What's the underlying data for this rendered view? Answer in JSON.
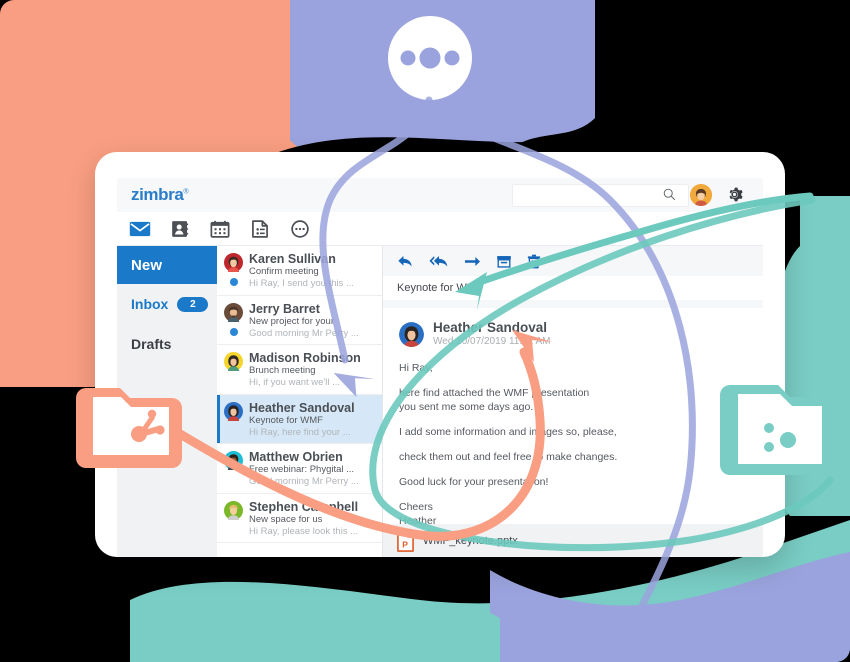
{
  "app": {
    "brand": "zimbra",
    "brand_mark": "®"
  },
  "header": {
    "search_placeholder": "",
    "search_value": "",
    "search_icon": "search-icon",
    "avatar_icon": "user-avatar",
    "settings_icon": "gear-icon"
  },
  "nav": {
    "items": [
      {
        "icon": "mail-icon",
        "label": "Mail",
        "active": true
      },
      {
        "icon": "contacts-icon",
        "label": "Contacts",
        "active": false
      },
      {
        "icon": "calendar-icon",
        "label": "Calendar",
        "active": false
      },
      {
        "icon": "tasks-icon",
        "label": "Tasks",
        "active": false
      },
      {
        "icon": "more-icon",
        "label": "More",
        "active": false
      }
    ]
  },
  "sidebar": {
    "new_label": "New",
    "folders": [
      {
        "label": "Inbox",
        "badge": "2",
        "active": true
      },
      {
        "label": "Drafts",
        "badge": "",
        "active": false
      }
    ]
  },
  "maillist": {
    "messages": [
      {
        "sender": "Karen Sullivan",
        "subject": "Confirm meeting",
        "preview": "Hi Ray, I send you this ...",
        "unread": true,
        "selected": false,
        "avatar_color": "#c0272d",
        "avatar_icon": "avatar-karen-sullivan"
      },
      {
        "sender": "Jerry Barret",
        "subject": "New project for your",
        "preview": "Good morning Mr Perry ...",
        "unread": true,
        "selected": false,
        "avatar_color": "#6b4c3b",
        "avatar_icon": "avatar-jerry-barret"
      },
      {
        "sender": "Madison Robinson",
        "subject": "Brunch meeting",
        "preview": "Hi, if you want we'll ...",
        "unread": false,
        "selected": false,
        "avatar_color": "#f5d52b",
        "avatar_icon": "avatar-madison-robinson"
      },
      {
        "sender": "Heather Sandoval",
        "subject": "Keynote for WMF",
        "preview": "Hi Ray, here find your ...",
        "unread": false,
        "selected": true,
        "avatar_color": "#2a6fc4",
        "avatar_icon": "avatar-heather-sandoval"
      },
      {
        "sender": "Matthew Obrien",
        "subject": "Free webinar: Phygital ...",
        "preview": "Good morning Mr Perry ...",
        "unread": false,
        "selected": false,
        "avatar_color": "#1fbcd6",
        "avatar_icon": "avatar-matthew-obrien"
      },
      {
        "sender": "Stephen Campbell",
        "subject": "New space for us",
        "preview": "Hi Ray, please look this ...",
        "unread": false,
        "selected": false,
        "avatar_color": "#7ab829",
        "avatar_icon": "avatar-stephen-campbell"
      }
    ]
  },
  "reader": {
    "toolbar": [
      {
        "icon": "reply-icon",
        "label": "Reply"
      },
      {
        "icon": "reply-all-icon",
        "label": "Reply All"
      },
      {
        "icon": "forward-icon",
        "label": "Forward"
      },
      {
        "icon": "archive-icon",
        "label": "Archive"
      },
      {
        "icon": "trash-icon",
        "label": "Delete"
      }
    ],
    "subject": "Keynote for WMF",
    "from": "Heather Sandoval",
    "date": "Wed 10/07/2019 11:02 AM",
    "avatar_icon": "avatar-heather-sandoval",
    "body": [
      "Hi Ray,",
      "here find attached the WMF presentation",
      "you sent me some days ago.",
      "I add some information and images so, please,",
      "check them out and feel free to make changes.",
      "Good luck for your presentation!",
      "Cheers",
      "Heather"
    ],
    "attachment": {
      "name": "WMF_keynote.pptx",
      "icon": "powerpoint-file-icon"
    }
  },
  "decorations": {
    "coral_folder": {
      "icon": "share-folder-icon",
      "color": "#f99e82"
    },
    "teal_folder": {
      "icon": "share-folder-icon",
      "color": "#79cdc4"
    },
    "chat_bubble": {
      "icon": "typing-dots-icon",
      "color": "#9aa3dd"
    },
    "arrows": [
      {
        "name": "purple-arrow",
        "color": "#9aa3dd"
      },
      {
        "name": "teal-arrow",
        "color": "#6cc9bd"
      },
      {
        "name": "coral-arrow",
        "color": "#f99e82"
      }
    ]
  },
  "colors": {
    "brand_blue": "#2a7dc9",
    "accent_blue": "#1a79c8",
    "coral": "#f99e82",
    "teal": "#79cdc4",
    "purple": "#9aa3dd",
    "black": "#000000"
  }
}
